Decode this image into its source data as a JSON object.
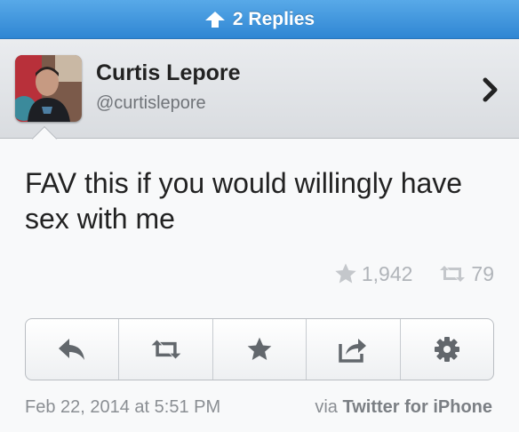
{
  "replies_bar": {
    "label": "2 Replies"
  },
  "user": {
    "display_name": "Curtis Lepore",
    "handle": "@curtislepore"
  },
  "tweet": {
    "text": "FAV this if you would willingly have sex with me",
    "favorites": "1,942",
    "retweets": "79"
  },
  "actions": [
    {
      "icon": "reply-icon"
    },
    {
      "icon": "retweet-icon"
    },
    {
      "icon": "star-icon"
    },
    {
      "icon": "share-icon"
    },
    {
      "icon": "gear-icon"
    }
  ],
  "footer": {
    "timestamp": "Feb 22, 2014 at 5:51 PM",
    "via_prefix": "via",
    "client": "Twitter for iPhone"
  },
  "colors": {
    "bar_blue": "#3b90da",
    "icon_gray": "#62676c",
    "stat_gray": "#b0b4b9"
  }
}
